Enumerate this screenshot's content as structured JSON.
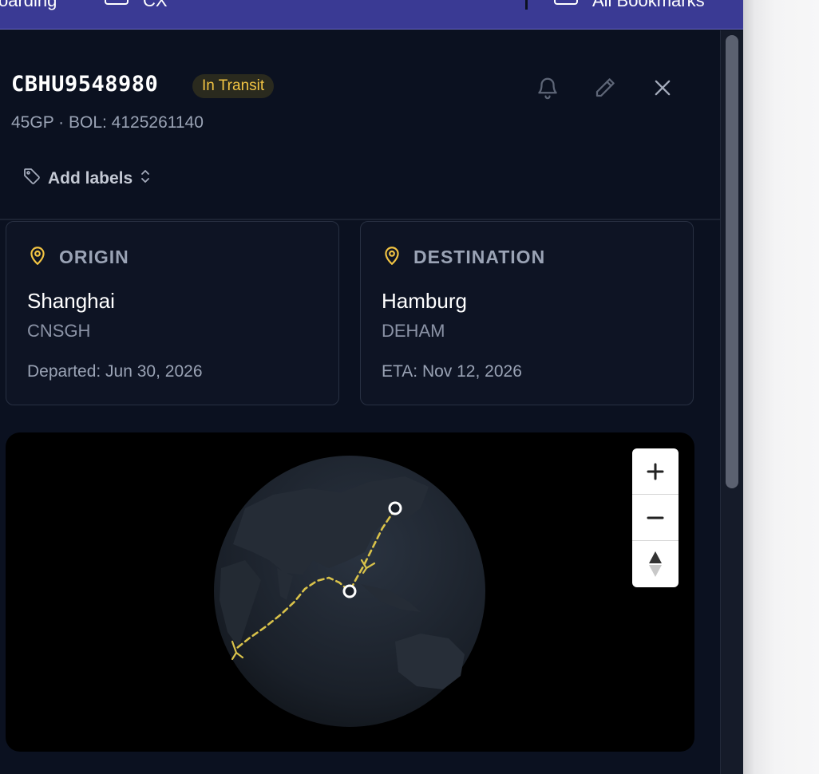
{
  "topbar": {
    "items": [
      {
        "label": "oarding"
      },
      {
        "label": "CX"
      },
      {
        "label": "All Bookmarks"
      }
    ]
  },
  "header": {
    "container_id": "CBHU9548980",
    "status": "In Transit",
    "subtitle": "45GP · BOL: 4125261140",
    "icons": [
      "bell-icon",
      "pencil-icon",
      "close-icon"
    ]
  },
  "labels_button": {
    "label": "Add labels"
  },
  "origin": {
    "heading": "ORIGIN",
    "city": "Shanghai",
    "code": "CNSGH",
    "date_text": "Departed: Jun 30, 2026"
  },
  "destination": {
    "heading": "DESTINATION",
    "city": "Hamburg",
    "code": "DEHAM",
    "date_text": "ETA: Nov 12, 2026"
  },
  "map": {
    "controls": [
      "zoom-in",
      "zoom-out",
      "reset-north"
    ]
  },
  "colors": {
    "accent_yellow": "#f2c443",
    "topbar": "#3a3a94",
    "background": "#0b1120",
    "card_border": "#283042"
  }
}
